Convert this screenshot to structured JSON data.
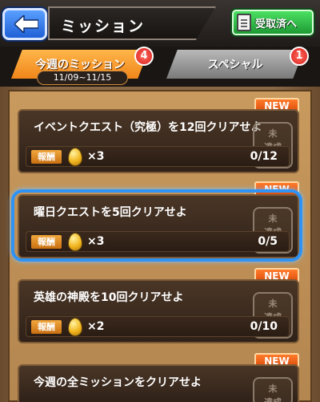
{
  "header": {
    "title": "ミッション",
    "received_button": "受取済へ"
  },
  "tabs": [
    {
      "label": "今週のミッション",
      "badge": "4",
      "date_range": "11/09~11/15"
    },
    {
      "label": "スペシャル",
      "badge": "1"
    }
  ],
  "missions": [
    {
      "title": "イベントクエスト（究極）を12回クリアせよ",
      "reward_label": "報酬",
      "reward_qty": "×3",
      "progress": "0/12",
      "badge": "NEW",
      "stamp": "未\n達成"
    },
    {
      "title": "曜日クエストを5回クリアせよ",
      "reward_label": "報酬",
      "reward_qty": "×3",
      "progress": "0/5",
      "badge": "NEW",
      "stamp": "未\n達成"
    },
    {
      "title": "英雄の神殿を10回クリアせよ",
      "reward_label": "報酬",
      "reward_qty": "×2",
      "progress": "0/10",
      "badge": "NEW",
      "stamp": "未\n達成"
    },
    {
      "title": "今週の全ミッションをクリアせよ",
      "reward_label": "",
      "reward_qty": "",
      "progress": "",
      "badge": "NEW",
      "stamp": "未\n達成"
    }
  ],
  "colors": {
    "accent_orange": "#f0861a",
    "highlight_blue": "#2f93f5",
    "badge_red": "#d71f1f",
    "new_orange": "#d94b0a"
  }
}
